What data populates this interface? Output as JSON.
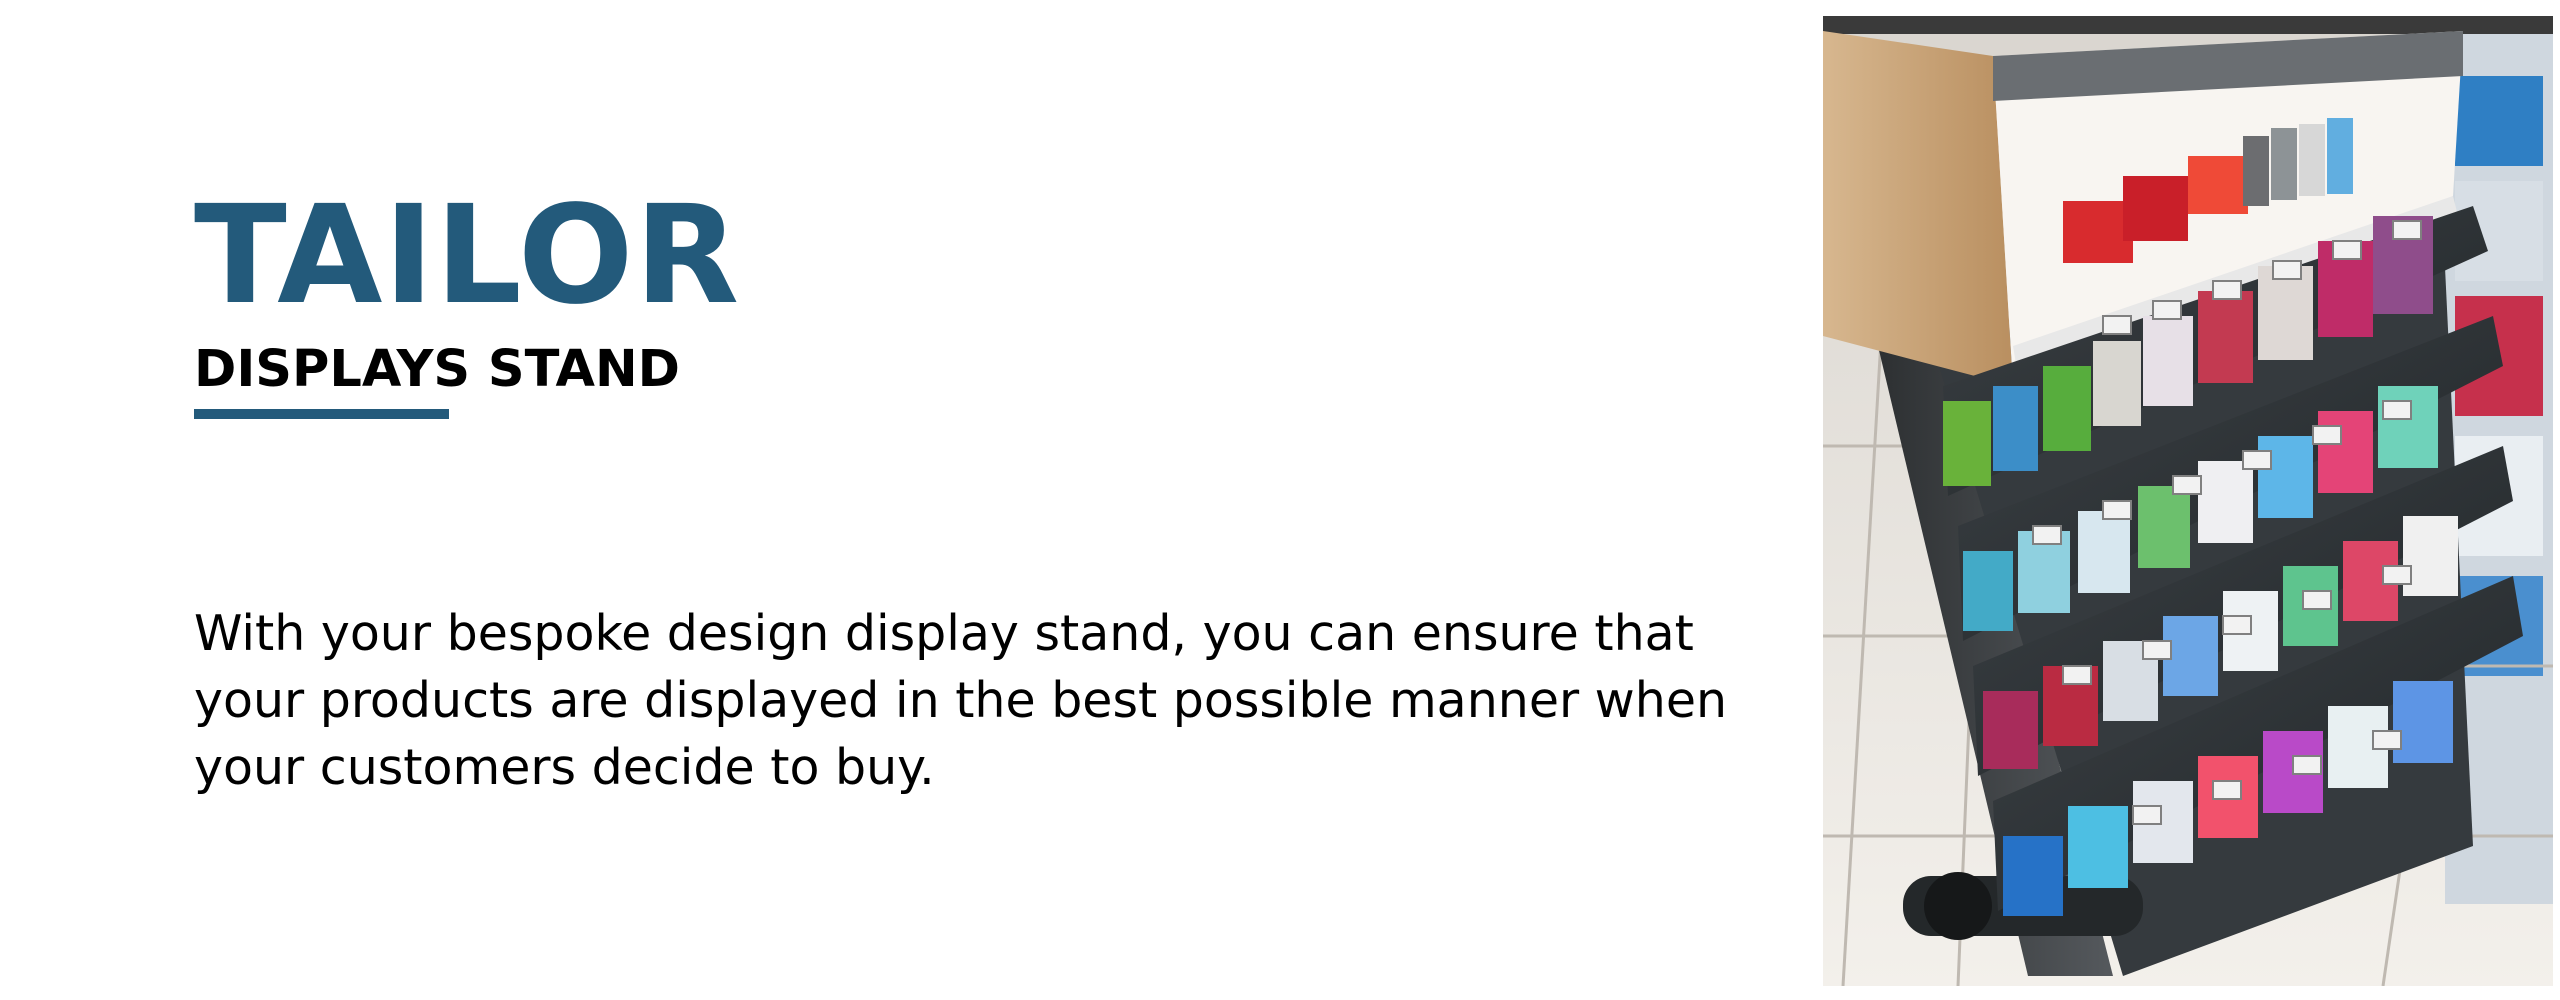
{
  "hero": {
    "title": "TAILOR",
    "subtitle": "DISPLAYS STAND",
    "body": "With your bespoke design display stand, you can ensure that your products are displayed in the best possible manner when your customers decide to buy."
  },
  "image": {
    "subject": "display-stand-photo"
  },
  "colors": {
    "accent": "#235a7b",
    "text": "#000000",
    "background": "#ffffff"
  }
}
